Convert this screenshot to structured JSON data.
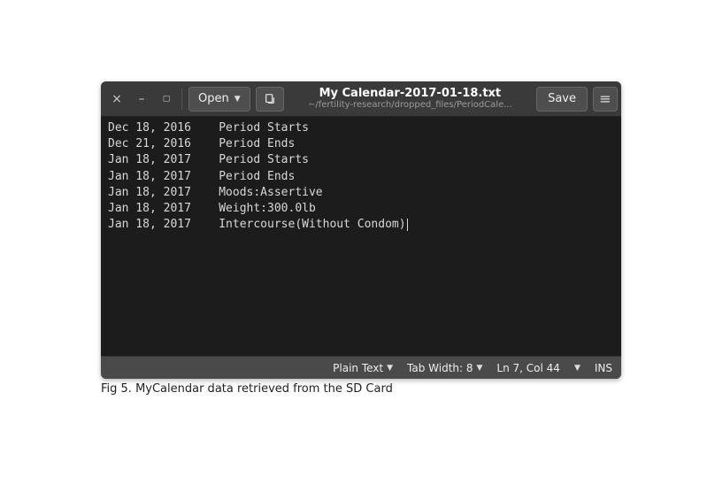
{
  "titlebar": {
    "open_label": "Open",
    "title": "My Calendar-2017-01-18.txt",
    "subtitle": "~/fertility-research/dropped_files/PeriodCale...",
    "save_label": "Save"
  },
  "editor": {
    "lines": [
      {
        "date": "Dec 18, 2016",
        "text": "Period Starts"
      },
      {
        "date": "Dec 21, 2016",
        "text": "Period Ends"
      },
      {
        "date": "Jan 18, 2017",
        "text": "Period Starts"
      },
      {
        "date": "Jan 18, 2017",
        "text": "Period Ends"
      },
      {
        "date": "Jan 18, 2017",
        "text": "Moods:Assertive"
      },
      {
        "date": "Jan 18, 2017",
        "text": "Weight:300.0lb"
      },
      {
        "date": "Jan 18, 2017",
        "text": "Intercourse(Without Condom)"
      }
    ]
  },
  "statusbar": {
    "syntax": "Plain Text",
    "tabwidth_label": "Tab Width: 8",
    "position": "Ln 7, Col 44",
    "insert_mode": "INS"
  },
  "caption": "Fig 5. MyCalendar data retrieved from the SD Card"
}
